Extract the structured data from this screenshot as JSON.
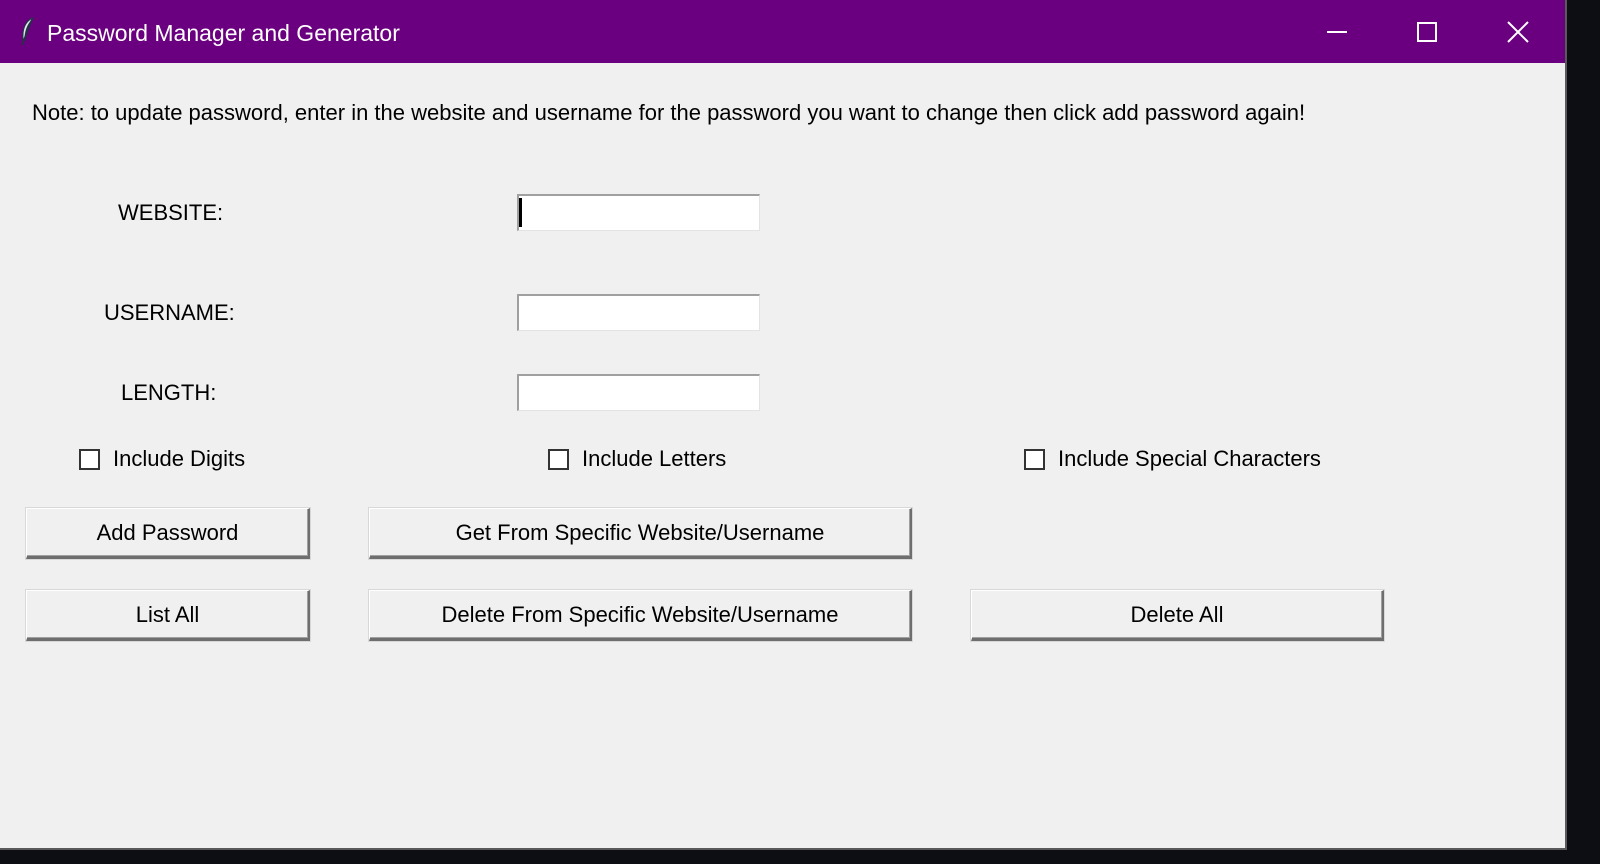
{
  "window": {
    "title": "Password Manager and Generator",
    "title_icon": "feather-icon",
    "controls": {
      "minimize_icon": "minimize-icon",
      "maximize_icon": "maximize-icon",
      "close_icon": "close-icon"
    },
    "titlebar_color": "#6a007f"
  },
  "note": "Note: to update password, enter in the website and username for the password you want to change then click add password again!",
  "form": {
    "website": {
      "label": "WEBSITE:",
      "value": ""
    },
    "username": {
      "label": "USERNAME:",
      "value": ""
    },
    "length": {
      "label": "LENGTH:",
      "value": ""
    }
  },
  "options": {
    "digits": {
      "label": "Include Digits",
      "checked": false
    },
    "letters": {
      "label": "Include Letters",
      "checked": false
    },
    "special": {
      "label": "Include Special Characters",
      "checked": false
    }
  },
  "buttons": {
    "add_password": "Add Password",
    "get_specific": "Get From Specific Website/Username",
    "list_all": "List All",
    "delete_specific": "Delete From Specific Website/Username",
    "delete_all": "Delete All"
  }
}
